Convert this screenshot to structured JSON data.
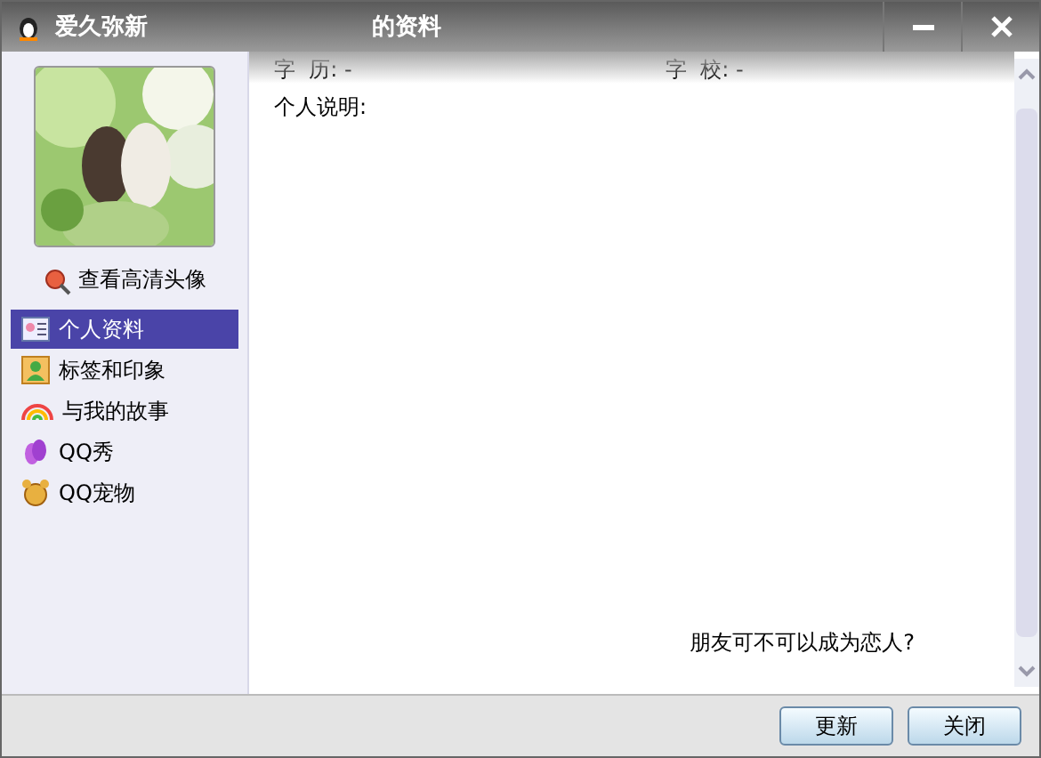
{
  "window": {
    "title_name": "爱久弥新",
    "title_suffix": "的资料"
  },
  "sidebar": {
    "view_hd_link": "查看高清头像",
    "items": [
      {
        "label": "个人资料",
        "selected": true
      },
      {
        "label": "标签和印象",
        "selected": false
      },
      {
        "label": "与我的故事",
        "selected": false
      },
      {
        "label": "QQ秀",
        "selected": false
      },
      {
        "label": "QQ宠物",
        "selected": false
      }
    ]
  },
  "profile": {
    "fields": [
      {
        "label": "字  历:",
        "value": "-"
      },
      {
        "label": "字  校:",
        "value": "-"
      }
    ],
    "bio_label": "个人说明:",
    "bio_text": "朋友可不可以成为恋人?"
  },
  "buttons": [
    "更新",
    "关闭"
  ]
}
